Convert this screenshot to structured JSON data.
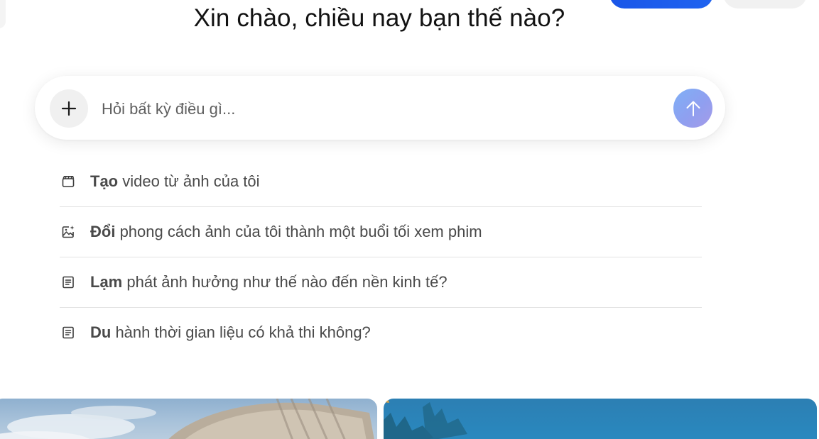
{
  "greeting": "Xin chào, chiều nay bạn thế nào?",
  "composer": {
    "placeholder": "Hỏi bất kỳ điều gì...",
    "add_icon": "plus-icon",
    "send_icon": "arrow-up-icon"
  },
  "suggestions": [
    {
      "icon": "clapperboard-icon",
      "bold": "Tạo",
      "rest": " video từ ảnh của tôi"
    },
    {
      "icon": "image-sparkle-icon",
      "bold": "Đổi",
      "rest": " phong cách ảnh của tôi thành một buổi tối xem phim"
    },
    {
      "icon": "document-icon",
      "bold": "Lạm",
      "rest": " phát ảnh hưởng như thế nào đến nền kinh tế?"
    },
    {
      "icon": "document-icon",
      "bold": "Du",
      "rest": " hành thời gian liệu có khả thi không?"
    }
  ],
  "cards": [
    {
      "name": "image-card-clouds-arch"
    },
    {
      "name": "image-card-blue-sky-trees"
    }
  ],
  "colors": {
    "primary_button": "#1a56e8",
    "send_button_gradient_start": "#7fb0f6",
    "send_button_gradient_end": "#a59be8",
    "suggestion_text": "#4a4a4a",
    "divider": "#e2e2e2"
  }
}
